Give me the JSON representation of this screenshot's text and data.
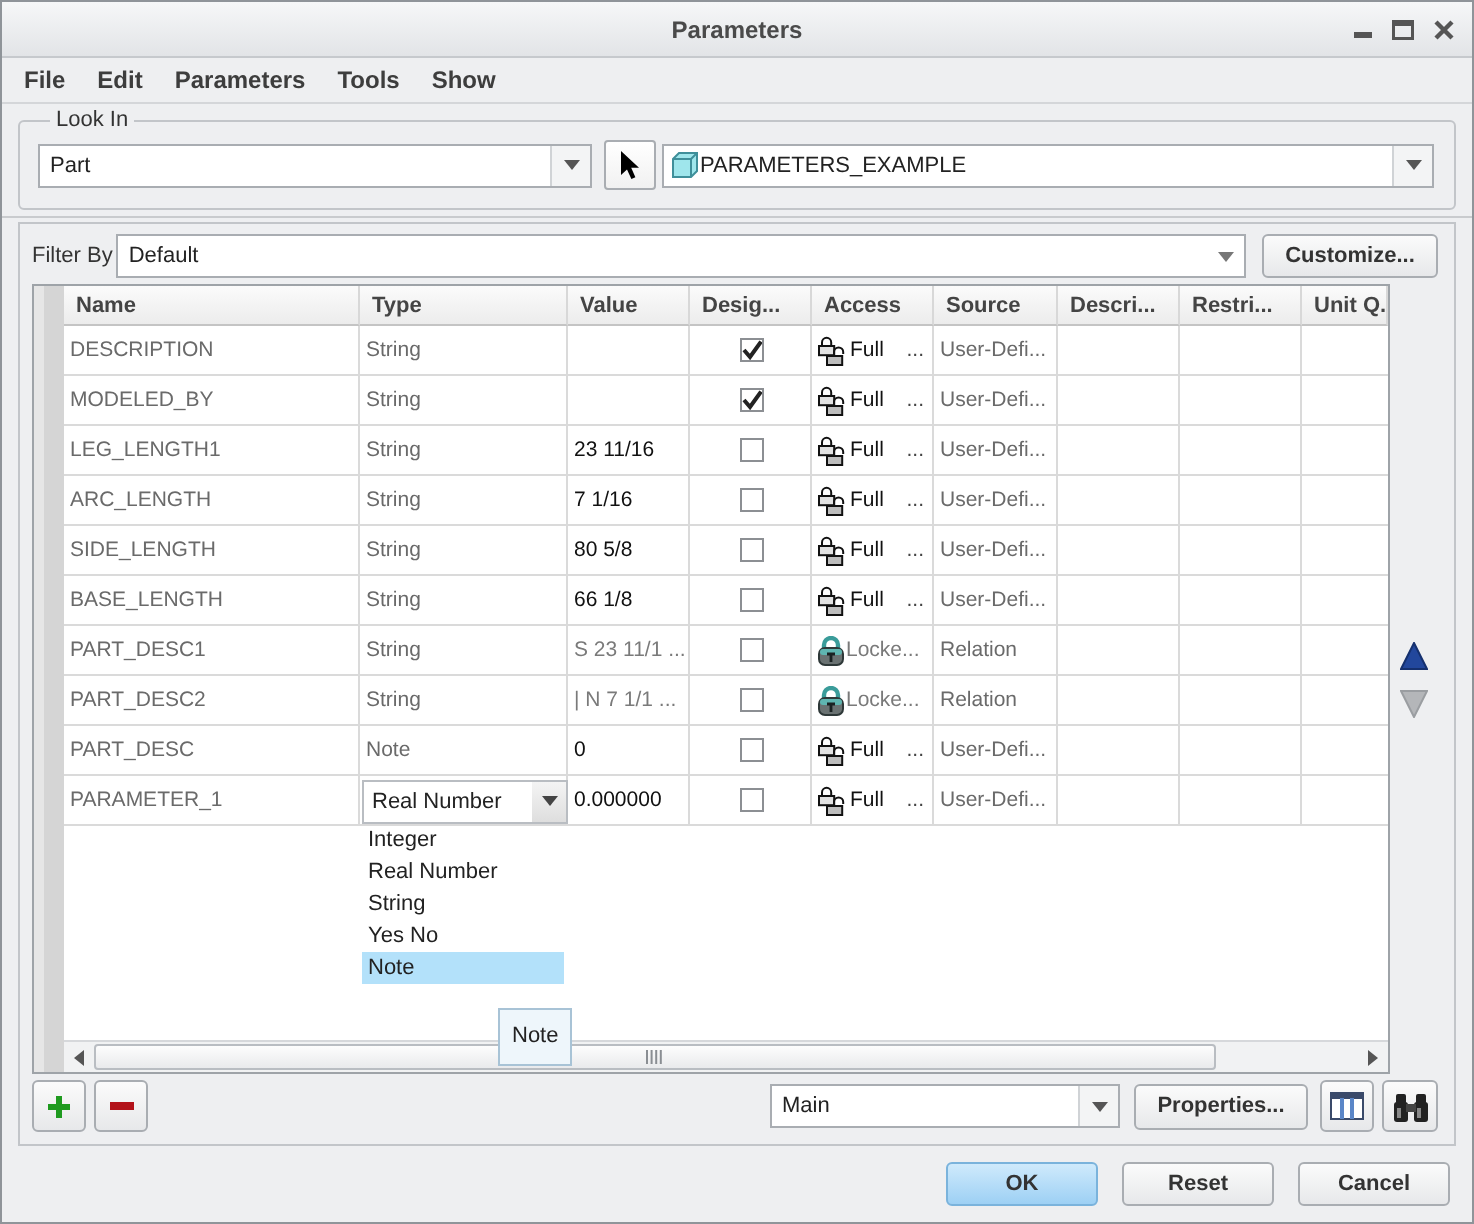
{
  "window": {
    "title": "Parameters"
  },
  "menu": [
    "File",
    "Edit",
    "Parameters",
    "Tools",
    "Show"
  ],
  "look_in": {
    "label": "Look In",
    "scope": "Part",
    "model": "PARAMETERS_EXAMPLE"
  },
  "filter": {
    "label": "Filter By",
    "value": "Default",
    "button": "Customize..."
  },
  "table": {
    "columns": [
      "Name",
      "Type",
      "Value",
      "Desig...",
      "Access",
      "Source",
      "Descri...",
      "Restri...",
      "Unit Q."
    ],
    "rows": [
      {
        "name": "DESCRIPTION",
        "type": "String",
        "designate": true,
        "access": {
          "kind": "full",
          "label": "Full",
          "more": "..."
        },
        "source": "User-Defi...",
        "editing": false
      },
      {
        "name": "MODELED_BY",
        "type": "String",
        "designate": true,
        "access": {
          "kind": "full",
          "label": "Full",
          "more": "..."
        },
        "source": "User-Defi...",
        "editing": false
      },
      {
        "name": "LEG_LENGTH1",
        "type": "String",
        "value": "23 11/16",
        "designate": false,
        "access": {
          "kind": "full",
          "label": "Full",
          "more": "..."
        },
        "source": "User-Defi...",
        "editing": false
      },
      {
        "name": "ARC_LENGTH",
        "type": "String",
        "value": "7 1/16",
        "designate": false,
        "access": {
          "kind": "full",
          "label": "Full",
          "more": "..."
        },
        "source": "User-Defi...",
        "editing": false
      },
      {
        "name": "SIDE_LENGTH",
        "type": "String",
        "value": "80 5/8",
        "designate": false,
        "access": {
          "kind": "full",
          "label": "Full",
          "more": "..."
        },
        "source": "User-Defi...",
        "editing": false
      },
      {
        "name": "BASE_LENGTH",
        "type": "String",
        "value": "66 1/8",
        "designate": false,
        "access": {
          "kind": "full",
          "label": "Full",
          "more": "..."
        },
        "source": "User-Defi...",
        "editing": false
      },
      {
        "name": "PART_DESC1",
        "type": "String",
        "value": "S 23 11/1 ...",
        "designate": false,
        "access": {
          "kind": "locked",
          "label": "Locke..."
        },
        "source": "Relation",
        "editing": false
      },
      {
        "name": "PART_DESC2",
        "type": "String",
        "value": "| N 7 1/1 ...",
        "designate": false,
        "access": {
          "kind": "locked",
          "label": "Locke..."
        },
        "source": "Relation",
        "editing": false
      },
      {
        "name": "PART_DESC",
        "type": "Note",
        "value": "0",
        "designate": false,
        "access": {
          "kind": "full",
          "label": "Full",
          "more": "..."
        },
        "source": "User-Defi...",
        "editing": false
      },
      {
        "name": "PARAMETER_1",
        "type": "Real Number",
        "value": "0.000000",
        "designate": false,
        "access": {
          "kind": "full",
          "label": "Full",
          "more": "..."
        },
        "source": "User-Defi...",
        "editing": true
      }
    ],
    "type_options": [
      {
        "label": "Integer",
        "selected": false
      },
      {
        "label": "Real Number",
        "selected": false
      },
      {
        "label": "String",
        "selected": false
      },
      {
        "label": "Yes No",
        "selected": false
      },
      {
        "label": "Note",
        "selected": true
      }
    ],
    "tooltip": "Note"
  },
  "reorder": [
    {
      "kind": "up",
      "disabled": false
    },
    {
      "kind": "down",
      "disabled": true
    }
  ],
  "toolbar": {
    "view": "Main",
    "button": "Properties..."
  },
  "buttons": [
    {
      "label": "OK",
      "default": true
    },
    {
      "label": "Reset",
      "default": false
    },
    {
      "label": "Cancel",
      "default": false
    }
  ]
}
